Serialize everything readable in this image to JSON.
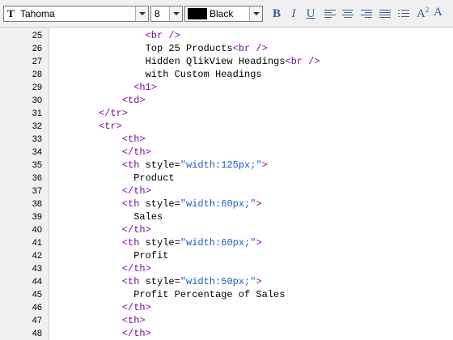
{
  "toolbar": {
    "font_name": "Tahoma",
    "font_size": "8",
    "color_name": "Black",
    "color_hex": "#000000",
    "bold_label": "B",
    "italic_label": "I",
    "underline_label": "U",
    "superscript_label": "A",
    "superscript_mark": "2",
    "text_color_label": "A"
  },
  "code": {
    "lines": [
      {
        "num": "25",
        "indent": 6,
        "parts": [
          {
            "t": "tag",
            "v": "<br />"
          }
        ]
      },
      {
        "num": "26",
        "indent": 6,
        "parts": [
          {
            "t": "text",
            "v": "Top 25 Products"
          },
          {
            "t": "tag",
            "v": "<br />"
          }
        ]
      },
      {
        "num": "27",
        "indent": 6,
        "parts": [
          {
            "t": "text",
            "v": "Hidden QlikView Headings"
          },
          {
            "t": "tag",
            "v": "<br />"
          }
        ]
      },
      {
        "num": "28",
        "indent": 6,
        "parts": [
          {
            "t": "text",
            "v": "with Custom Headings"
          }
        ]
      },
      {
        "num": "29",
        "indent": 5,
        "parts": [
          {
            "t": "tag",
            "v": "<h1>"
          }
        ]
      },
      {
        "num": "30",
        "indent": 4,
        "parts": [
          {
            "t": "tag",
            "v": "<td>"
          }
        ]
      },
      {
        "num": "31",
        "indent": 2,
        "parts": [
          {
            "t": "tag",
            "v": "</tr>"
          }
        ]
      },
      {
        "num": "32",
        "indent": 2,
        "parts": [
          {
            "t": "tag",
            "v": "<tr>"
          }
        ]
      },
      {
        "num": "33",
        "indent": 4,
        "parts": [
          {
            "t": "tag",
            "v": "<th>"
          }
        ]
      },
      {
        "num": "34",
        "indent": 4,
        "parts": [
          {
            "t": "tag",
            "v": "</th>"
          }
        ]
      },
      {
        "num": "35",
        "indent": 4,
        "parts": [
          {
            "t": "tag",
            "v": "<th "
          },
          {
            "t": "attr",
            "v": "style="
          },
          {
            "t": "val",
            "v": "\"width:125px;\""
          },
          {
            "t": "tag",
            "v": ">"
          }
        ]
      },
      {
        "num": "36",
        "indent": 5,
        "parts": [
          {
            "t": "text",
            "v": "Product"
          }
        ]
      },
      {
        "num": "37",
        "indent": 4,
        "parts": [
          {
            "t": "tag",
            "v": "</th>"
          }
        ]
      },
      {
        "num": "38",
        "indent": 4,
        "parts": [
          {
            "t": "tag",
            "v": "<th "
          },
          {
            "t": "attr",
            "v": "style="
          },
          {
            "t": "val",
            "v": "\"width:60px;\""
          },
          {
            "t": "tag",
            "v": ">"
          }
        ]
      },
      {
        "num": "39",
        "indent": 5,
        "parts": [
          {
            "t": "text",
            "v": "Sales"
          }
        ]
      },
      {
        "num": "40",
        "indent": 4,
        "parts": [
          {
            "t": "tag",
            "v": "</th>"
          }
        ]
      },
      {
        "num": "41",
        "indent": 4,
        "parts": [
          {
            "t": "tag",
            "v": "<th "
          },
          {
            "t": "attr",
            "v": "style="
          },
          {
            "t": "val",
            "v": "\"width:60px;\""
          },
          {
            "t": "tag",
            "v": ">"
          }
        ]
      },
      {
        "num": "42",
        "indent": 5,
        "parts": [
          {
            "t": "text",
            "v": "Profit"
          }
        ]
      },
      {
        "num": "43",
        "indent": 4,
        "parts": [
          {
            "t": "tag",
            "v": "</th>"
          }
        ]
      },
      {
        "num": "44",
        "indent": 4,
        "parts": [
          {
            "t": "tag",
            "v": "<th "
          },
          {
            "t": "attr",
            "v": "style="
          },
          {
            "t": "val",
            "v": "\"width:50px;\""
          },
          {
            "t": "tag",
            "v": ">"
          }
        ]
      },
      {
        "num": "45",
        "indent": 5,
        "parts": [
          {
            "t": "text",
            "v": "Profit Percentage of Sales"
          }
        ]
      },
      {
        "num": "46",
        "indent": 4,
        "parts": [
          {
            "t": "tag",
            "v": "</th>"
          }
        ]
      },
      {
        "num": "47",
        "indent": 4,
        "parts": [
          {
            "t": "tag",
            "v": "<th>"
          }
        ]
      },
      {
        "num": "48",
        "indent": 4,
        "parts": [
          {
            "t": "tag",
            "v": "</th>"
          }
        ]
      }
    ]
  }
}
